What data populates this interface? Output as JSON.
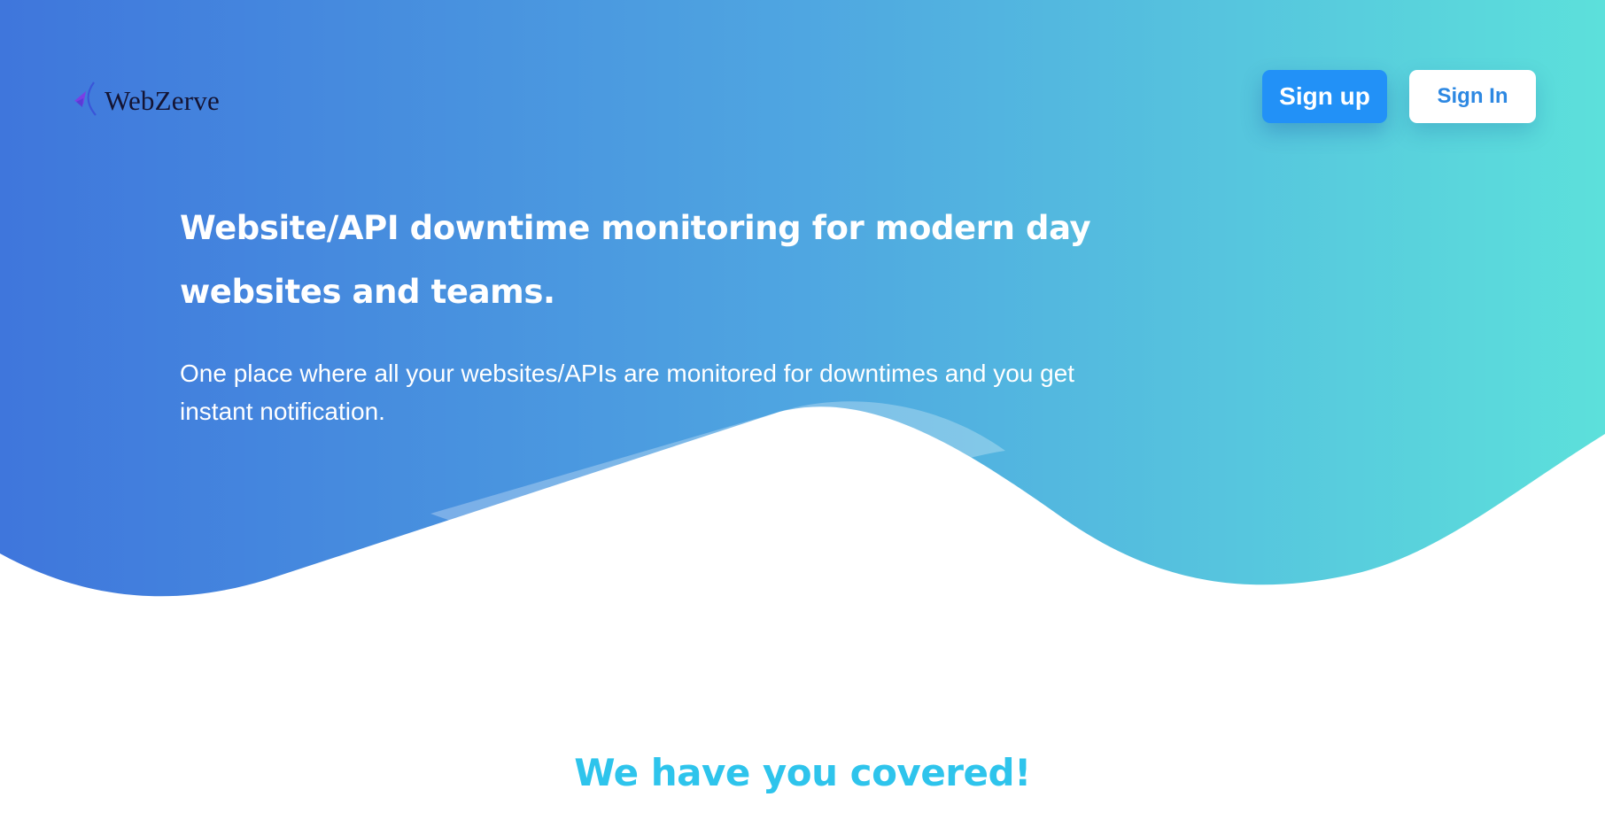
{
  "brand": {
    "name": "WebZerve",
    "logo_icon": "webzerve-logo-icon"
  },
  "nav": {
    "signup_label": "Sign up",
    "signin_label": "Sign In"
  },
  "hero": {
    "headline": "Website/API downtime monitoring for modern day websites and teams.",
    "subtext": "One place where all your websites/APIs are monitored for downtimes and you get instant notification."
  },
  "features": {
    "title": "We have you covered!"
  },
  "colors": {
    "gradient_start": "#3f76dc",
    "gradient_end": "#5ce0db",
    "signup_button": "#2291f7",
    "signin_text": "#2d88e2",
    "section_title": "#2ec4ec"
  }
}
